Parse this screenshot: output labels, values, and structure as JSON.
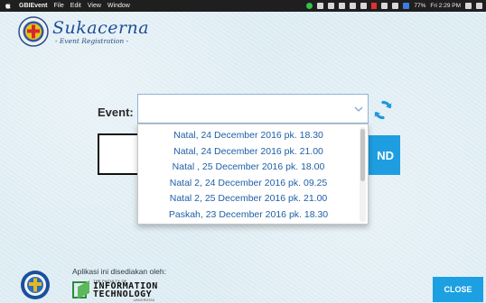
{
  "menubar": {
    "app_name": "GBIEvent",
    "menus": [
      "File",
      "Edit",
      "View",
      "Window"
    ],
    "battery": "77%",
    "clock": "Fri 2:29 PM"
  },
  "header": {
    "title": "Sukacerna",
    "subtitle": "- Event Registration -"
  },
  "form": {
    "event_label": "Event:",
    "selected_value": "",
    "submit_label": "ND"
  },
  "dropdown": {
    "options": [
      "Natal, 24 December 2016 pk. 18.30",
      "Natal, 24 December 2016 pk. 21.00",
      "Natal , 25 December 2016 pk. 18.00",
      "Natal 2, 24 December 2016 pk. 09.25",
      "Natal 2, 25 December 2016 pk. 21.00",
      "Paskah, 23 December 2016 pk. 18.30"
    ]
  },
  "footer": {
    "provided_text": "Aplikasi ini disediakan oleh:",
    "faculty_small": "THE FACULTY OF",
    "logo_line1": "INFORMATION",
    "logo_line2": "TECHNOLOGY",
    "university_small": "UNIVERSITAS",
    "close_label": "CLOSE"
  },
  "colors": {
    "accent": "#1ca0e2",
    "brand": "#1e4f96",
    "option_text": "#1f5fa6"
  }
}
